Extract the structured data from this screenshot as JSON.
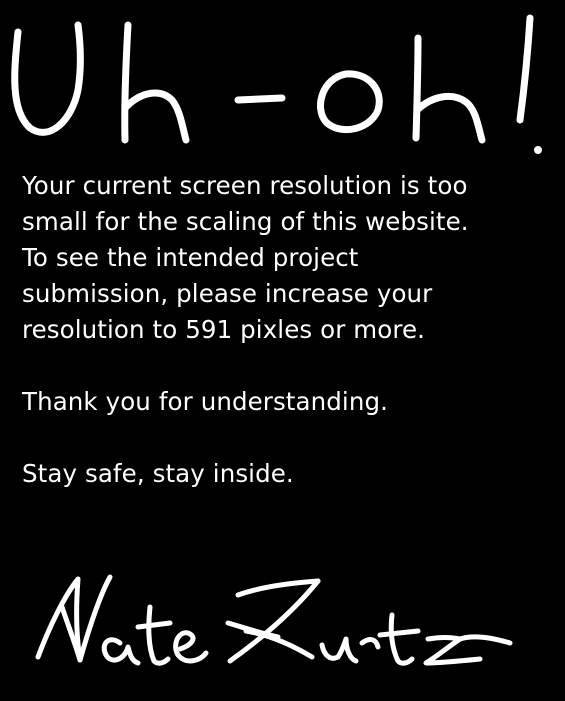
{
  "headline": "Uh-oh!",
  "message": {
    "paragraph_1": "Your current screen resolution is too\nsmall for the scaling of this website.\nTo see the intended project\nsubmission, please increase your\nresolution to 591 pixles or more.",
    "paragraph_2": "Thank you for understanding.",
    "paragraph_3": "Stay safe, stay inside."
  },
  "signature": "Nate Kurtz",
  "colors": {
    "background": "#000000",
    "text": "#ffffff"
  }
}
